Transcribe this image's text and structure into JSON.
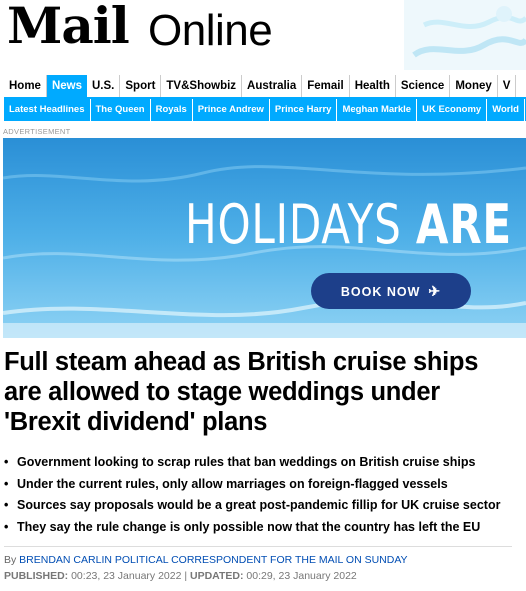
{
  "masthead": {
    "logo_mail": "Mail",
    "logo_online": "Online"
  },
  "nav_primary": [
    {
      "label": "Home",
      "active": false
    },
    {
      "label": "News",
      "active": true
    },
    {
      "label": "U.S.",
      "active": false
    },
    {
      "label": "Sport",
      "active": false
    },
    {
      "label": "TV&Showbiz",
      "active": false
    },
    {
      "label": "Australia",
      "active": false
    },
    {
      "label": "Femail",
      "active": false
    },
    {
      "label": "Health",
      "active": false
    },
    {
      "label": "Science",
      "active": false
    },
    {
      "label": "Money",
      "active": false
    },
    {
      "label": "V",
      "active": false
    }
  ],
  "nav_secondary": [
    "Latest Headlines",
    "The Queen",
    "Royals",
    "Prince Andrew",
    "Prince Harry",
    "Meghan Markle",
    "UK Economy",
    "World"
  ],
  "ad": {
    "label": "ADVERTISEMENT",
    "text_light": "HOLIDAYS ",
    "text_bold": "ARE C",
    "button_label": "BOOK NOW"
  },
  "article": {
    "headline": "Full steam ahead as British cruise ships are allowed to stage weddings under 'Brexit dividend' plans",
    "bullets": [
      "Government looking to scrap rules that ban weddings on British cruise ships",
      "Under the current rules, only allow marriages on foreign-flagged vessels",
      "Sources say proposals would be a great post-pandemic fillip for UK cruise sector",
      "They say the rule change is only possible now that the country has left the EU"
    ],
    "byline_prefix": "By ",
    "author": "BRENDAN CARLIN POLITICAL CORRESPONDENT FOR THE MAIL ON SUNDAY",
    "published_label": "PUBLISHED:",
    "published_value": "00:23, 23 January 2022",
    "separator": " | ",
    "updated_label": "UPDATED:",
    "updated_value": "00:29, 23 January 2022"
  },
  "colors": {
    "accent": "#00aaff",
    "button": "#1d3f8a",
    "author_link": "#004db3"
  }
}
